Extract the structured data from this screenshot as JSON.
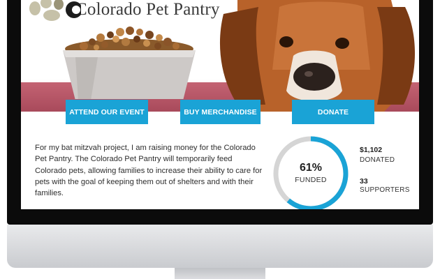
{
  "logo": {
    "text": "Colorado Pet Pantry"
  },
  "actions": {
    "attend_event": "ATTEND OUR EVENT",
    "buy_merchandise": "BUY MERCHANDISE",
    "donate": "DONATE"
  },
  "description": "For my bat mitzvah project, I am raising money for the Colorado Pet Pantry. The Colorado Pet Pantry will temporarily feed Colorado pets, allowing families to increase their ability to care for pets with the goal of keeping them out of shelters and with their families.",
  "progress": {
    "percent_text": "61%",
    "fraction": 0.61,
    "label": "FUNDED"
  },
  "stats": {
    "donated_value": "$1,102",
    "donated_label": "DONATED",
    "supporters_value": "33",
    "supporters_label": "SUPPORTERS"
  },
  "colors": {
    "accent": "#1aa3d6",
    "ring_track": "#d5d5d5"
  }
}
